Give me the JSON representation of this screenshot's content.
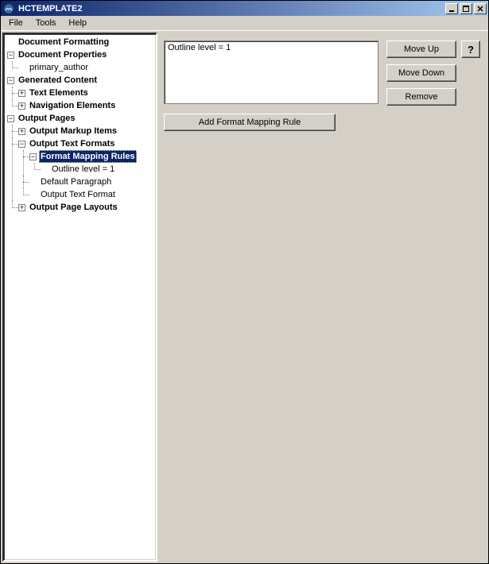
{
  "window": {
    "title": "HCTEMPLATE2"
  },
  "menu": {
    "file": "File",
    "tools": "Tools",
    "help": "Help"
  },
  "tree": {
    "doc_formatting": "Document Formatting",
    "doc_properties": "Document Properties",
    "primary_author": "primary_author",
    "generated_content": "Generated Content",
    "text_elements": "Text Elements",
    "nav_elements": "Navigation Elements",
    "output_pages": "Output Pages",
    "output_markup": "Output Markup Items",
    "output_text_formats": "Output Text Formats",
    "format_mapping_rules": "Format Mapping Rules",
    "outline_level_1": "Outline level = 1",
    "default_paragraph": "Default Paragraph",
    "output_text_format": "Output Text Format",
    "output_page_layouts": "Output Page Layouts"
  },
  "panel": {
    "list_item_0": "Outline level = 1",
    "move_up": "Move Up",
    "move_down": "Move Down",
    "remove": "Remove",
    "help": "?",
    "add_rule": "Add Format Mapping Rule"
  }
}
